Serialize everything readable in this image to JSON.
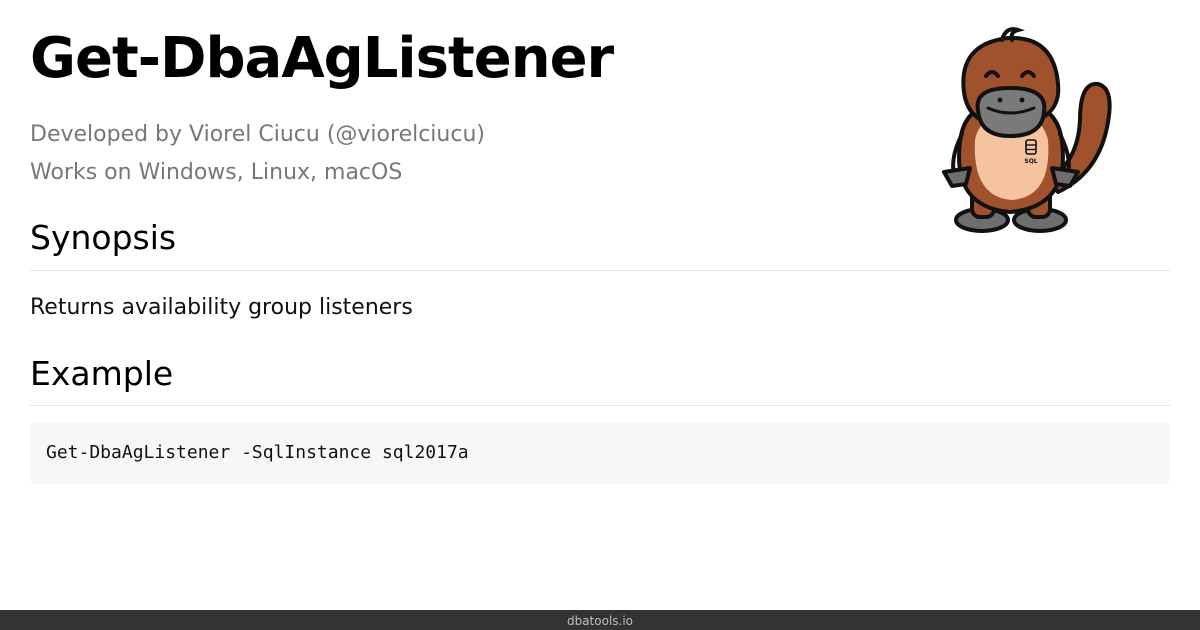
{
  "page": {
    "title": "Get-DbaAgListener",
    "author_line": "Developed by Viorel Ciucu (@viorelciucu)",
    "platforms_line": "Works on Windows, Linux, macOS"
  },
  "synopsis": {
    "heading": "Synopsis",
    "text": "Returns availability group listeners"
  },
  "example": {
    "heading": "Example",
    "code": "Get-DbaAgListener -SqlInstance sql2017a"
  },
  "mascot": {
    "icon": "platypus-mascot-icon",
    "badge_text": "SQL"
  },
  "footer": {
    "site": "dbatools.io"
  },
  "colors": {
    "mascot_fur": "#a0522d",
    "mascot_belly": "#f6c3a0",
    "mascot_bill": "#7a7a7a",
    "footer_bg": "#333333",
    "code_bg": "#f7f7f7"
  }
}
